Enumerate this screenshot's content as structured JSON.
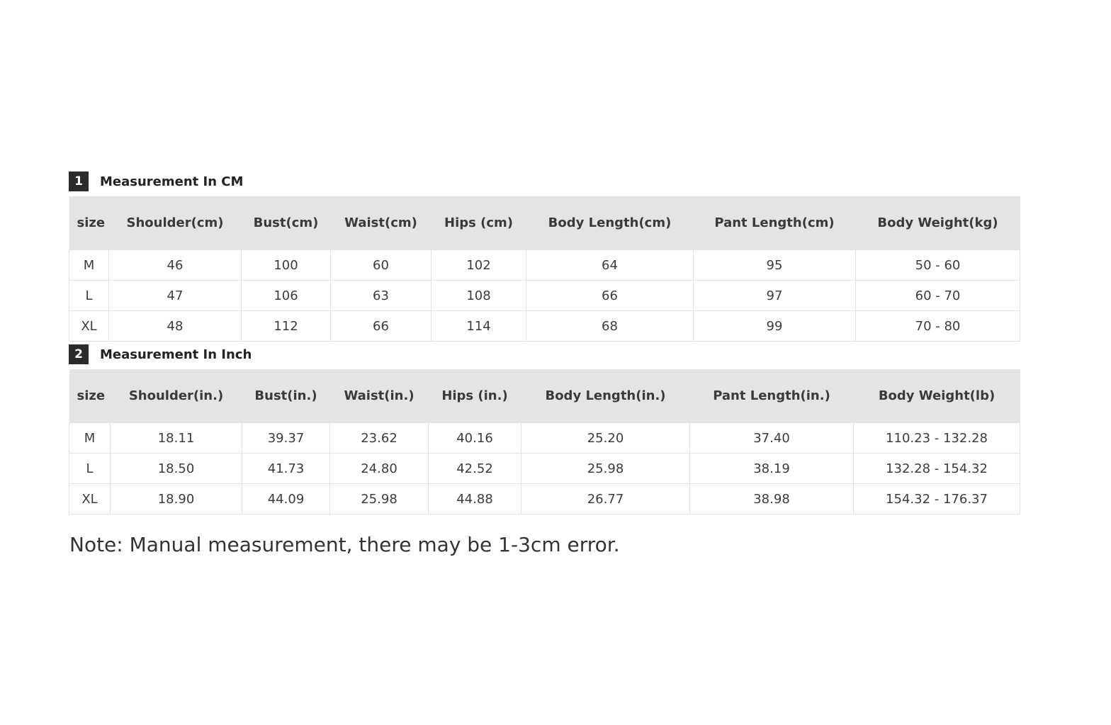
{
  "cm_section": {
    "number": "1",
    "title": "Measurement In CM",
    "headers": [
      "size",
      "Shoulder(cm)",
      "Bust(cm)",
      "Waist(cm)",
      "Hips (cm)",
      "Body Length(cm)",
      "Pant Length(cm)",
      "Body Weight(kg)"
    ],
    "rows": [
      [
        "M",
        "46",
        "100",
        "60",
        "102",
        "64",
        "95",
        "50 - 60"
      ],
      [
        "L",
        "47",
        "106",
        "63",
        "108",
        "66",
        "97",
        "60 - 70"
      ],
      [
        "XL",
        "48",
        "112",
        "66",
        "114",
        "68",
        "99",
        "70 - 80"
      ]
    ]
  },
  "inch_section": {
    "number": "2",
    "title": "Measurement In Inch",
    "headers": [
      "size",
      "Shoulder(in.)",
      "Bust(in.)",
      "Waist(in.)",
      "Hips (in.)",
      "Body Length(in.)",
      "Pant Length(in.)",
      "Body Weight(lb)"
    ],
    "rows": [
      [
        "M",
        "18.11",
        "39.37",
        "23.62",
        "40.16",
        "25.20",
        "37.40",
        "110.23 - 132.28"
      ],
      [
        "L",
        "18.50",
        "41.73",
        "24.80",
        "42.52",
        "25.98",
        "38.19",
        "132.28 - 154.32"
      ],
      [
        "XL",
        "18.90",
        "44.09",
        "25.98",
        "44.88",
        "26.77",
        "38.98",
        "154.32 - 176.37"
      ]
    ]
  },
  "note": "Note: Manual measurement, there may be 1-3cm error."
}
